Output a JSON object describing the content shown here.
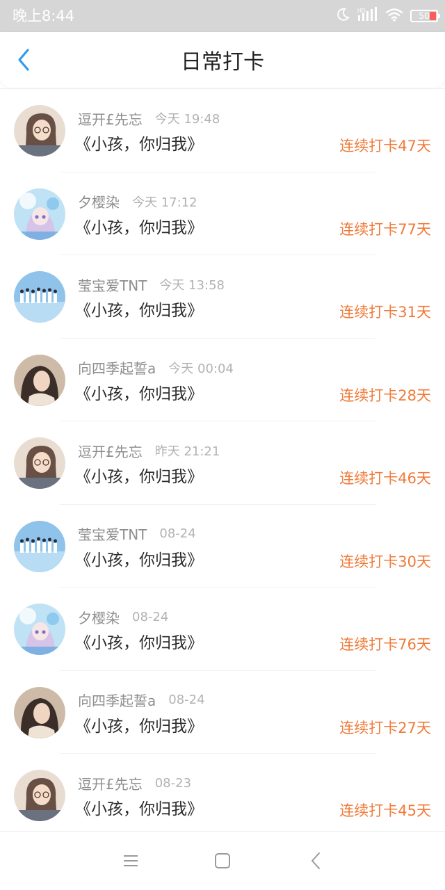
{
  "status_bar": {
    "time": "晚上8:44",
    "battery": "50",
    "network": "HD",
    "icons": [
      "moon-icon",
      "signal-icon",
      "wifi-icon",
      "battery-icon"
    ]
  },
  "nav": {
    "title": "日常打卡",
    "back_icon": "chevron-left-icon"
  },
  "items": [
    {
      "name": "逗开£先忘",
      "time": "今天 19:48",
      "title": "《小孩，你归我》",
      "streak": "连续打卡47天",
      "avatar": "anime-girl-glasses"
    },
    {
      "name": "夕樱染",
      "time": "今天 17:12",
      "title": "《小孩，你归我》",
      "streak": "连续打卡77天",
      "avatar": "anime-girl-blue"
    },
    {
      "name": "莹宝爱TNT",
      "time": "今天 13:58",
      "title": "《小孩，你归我》",
      "streak": "连续打卡31天",
      "avatar": "group-photo"
    },
    {
      "name": "向四季起誓a",
      "time": "今天 00:04",
      "title": "《小孩，你归我》",
      "streak": "连续打卡28天",
      "avatar": "girl-photo"
    },
    {
      "name": "逗开£先忘",
      "time": "昨天 21:21",
      "title": "《小孩，你归我》",
      "streak": "连续打卡46天",
      "avatar": "anime-girl-glasses"
    },
    {
      "name": "莹宝爱TNT",
      "time": "08-24",
      "title": "《小孩，你归我》",
      "streak": "连续打卡30天",
      "avatar": "group-photo"
    },
    {
      "name": "夕樱染",
      "time": "08-24",
      "title": "《小孩，你归我》",
      "streak": "连续打卡76天",
      "avatar": "anime-girl-blue"
    },
    {
      "name": "向四季起誓a",
      "time": "08-24",
      "title": "《小孩，你归我》",
      "streak": "连续打卡27天",
      "avatar": "girl-photo"
    },
    {
      "name": "逗开£先忘",
      "time": "08-23",
      "title": "《小孩，你归我》",
      "streak": "连续打卡45天",
      "avatar": "anime-girl-glasses"
    }
  ],
  "bottom_nav": {
    "buttons": [
      "menu-icon",
      "home-icon",
      "back-icon"
    ]
  },
  "colors": {
    "accent": "#2e9bf0",
    "streak": "#f07a38",
    "status_bar": "#d6d6d6"
  }
}
